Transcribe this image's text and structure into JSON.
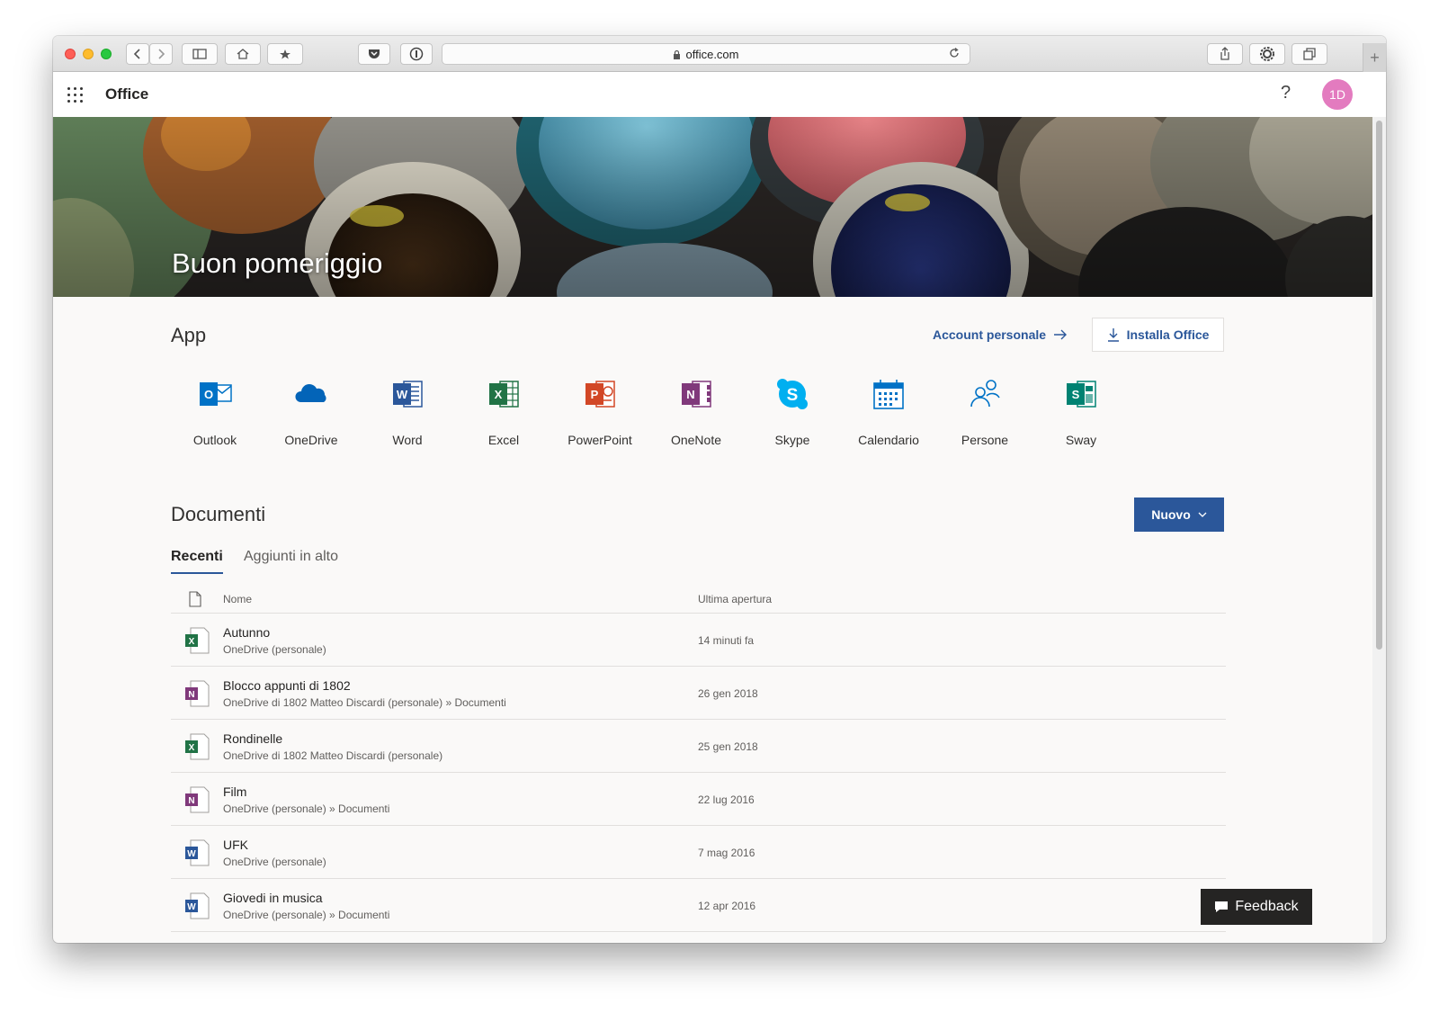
{
  "browser": {
    "url": "office.com"
  },
  "header": {
    "brand": "Office",
    "help": "?",
    "avatar": "1D"
  },
  "hero": {
    "greeting": "Buon pomeriggio"
  },
  "apps_section": {
    "title": "App",
    "account_link": "Account personale",
    "install_label": "Installa Office",
    "apps": [
      {
        "label": "Outlook",
        "icon": "outlook-icon",
        "color": "#0072c6"
      },
      {
        "label": "OneDrive",
        "icon": "onedrive-icon",
        "color": "#0364b8"
      },
      {
        "label": "Word",
        "icon": "word-icon",
        "color": "#2b579a"
      },
      {
        "label": "Excel",
        "icon": "excel-icon",
        "color": "#217346"
      },
      {
        "label": "PowerPoint",
        "icon": "powerpoint-icon",
        "color": "#d24726"
      },
      {
        "label": "OneNote",
        "icon": "onenote-icon",
        "color": "#80397b"
      },
      {
        "label": "Skype",
        "icon": "skype-icon",
        "color": "#00aff0"
      },
      {
        "label": "Calendario",
        "icon": "calendar-icon",
        "color": "#0072c6"
      },
      {
        "label": "Persone",
        "icon": "people-icon",
        "color": "#0072c6"
      },
      {
        "label": "Sway",
        "icon": "sway-icon",
        "color": "#008272"
      }
    ]
  },
  "documents": {
    "title": "Documenti",
    "new_label": "Nuovo",
    "tabs": [
      "Recenti",
      "Aggiunti in alto"
    ],
    "columns": [
      "Nome",
      "Ultima apertura"
    ],
    "rows": [
      {
        "name": "Autunno",
        "path": "OneDrive (personale)",
        "date": "14 minuti fa",
        "type": "excel"
      },
      {
        "name": "Blocco appunti di 1802",
        "path": "OneDrive di 1802 Matteo Discardi (personale) » Documenti",
        "date": "26 gen 2018",
        "type": "onenote"
      },
      {
        "name": "Rondinelle",
        "path": "OneDrive di 1802 Matteo Discardi (personale)",
        "date": "25 gen 2018",
        "type": "excel"
      },
      {
        "name": "Film",
        "path": "OneDrive (personale) » Documenti",
        "date": "22 lug 2016",
        "type": "onenote"
      },
      {
        "name": "UFK",
        "path": "OneDrive (personale)",
        "date": "7 mag 2016",
        "type": "word"
      },
      {
        "name": "Giovedi in musica",
        "path": "OneDrive (personale) » Documenti",
        "date": "12 apr 2016",
        "type": "word"
      }
    ]
  },
  "feedback": {
    "label": "Feedback"
  },
  "colors": {
    "accent": "#2b579a",
    "avatar": "#e37bbf"
  }
}
